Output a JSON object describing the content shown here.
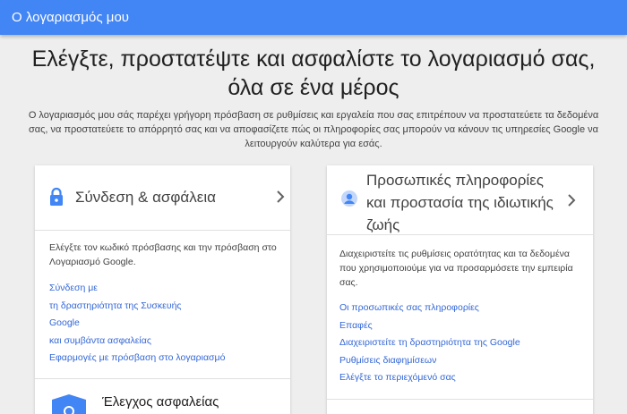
{
  "header": {
    "title": "Ο λογαριασμός μου"
  },
  "hero": {
    "title": "Ελέγξτε, προστατέψτε και ασφαλίστε το λογαριασμό σας, όλα σε ένα μέρος",
    "description": "Ο λογαριασμός μου σάς παρέχει γρήγορη πρόσβαση σε ρυθμίσεις και εργαλεία που σας επιτρέπουν να προστατεύετε τα δεδομένα σας, να προστατεύετε το απόρρητό σας και να αποφασίζετε πώς οι πληροφορίες σας μπορούν να κάνουν τις υπηρεσίες Google να λειτουργούν καλύτερα για εσάς."
  },
  "cards": {
    "security": {
      "title": "Σύνδεση & ασφάλεια",
      "icon": "lock-icon",
      "description": "Ελέγξτε τον κωδικό πρόσβασης και την πρόσβαση στο Λογαριασμό Google.",
      "links": [
        "Σύνδεση με",
        "τη δραστηριότητα της Συσκευής",
        "Google",
        "και συμβάντα ασφαλείας",
        "Εφαρμογές με πρόσβαση στο λογαριασμό"
      ],
      "subsection_title": "Έλεγχος ασφαλείας",
      "subsection_icon": "shield-icon"
    },
    "privacy": {
      "title": "Προσωπικές πληροφορίες και προστασία της ιδιωτικής ζωής",
      "icon": "person-icon",
      "description": "Διαχειριστείτε τις ρυθμίσεις ορατότητας και τα δεδομένα που χρησιμοποιούμε για να προσαρμόσετε την εμπειρία σας.",
      "links": [
        "Οι προσωπικές σας πληροφορίες",
        "Επαφές",
        "Διαχειριστείτε τη δραστηριότητα της Google",
        "Ρυθμίσεις διαφημίσεων",
        "Ελέγξτε το περιεχόμενό σας"
      ]
    }
  },
  "colors": {
    "accent": "#4285f4",
    "link": "#3367d6",
    "background": "#eeeeee"
  }
}
